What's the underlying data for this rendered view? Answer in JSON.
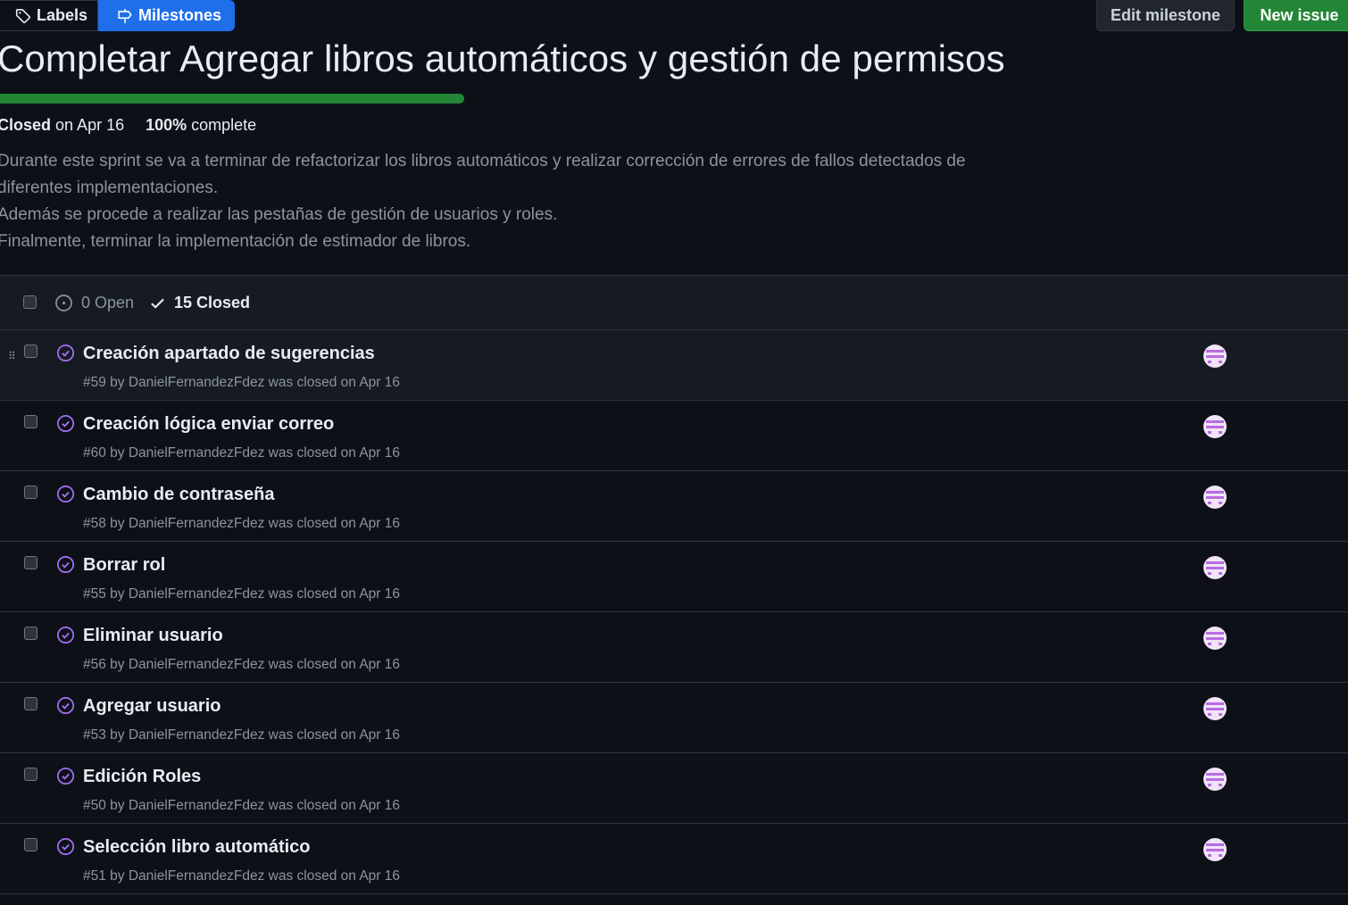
{
  "nav": {
    "labels_label": "Labels",
    "milestones_label": "Milestones",
    "edit_milestone_label": "Edit milestone",
    "new_issue_label": "New issue"
  },
  "milestone": {
    "title": "Completar Agregar libros automáticos y gestión de permisos",
    "progress_fraction": 1.0,
    "status": "Closed",
    "status_date": "on Apr 16",
    "percent": "100%",
    "percent_suffix": "complete",
    "description": [
      "Durante este sprint se va a terminar de refactorizar los libros automáticos y realizar corrección de errores de fallos detectados de",
      "diferentes implementaciones.",
      "Además se procede a realizar las pestañas de gestión de usuarios y roles.",
      "Finalmente, terminar la implementación de estimador de libros."
    ]
  },
  "list": {
    "open_count": "0 Open",
    "closed_count": "15 Closed",
    "issues": [
      {
        "title": "Creación apartado de sugerencias",
        "subtitle": "#59 by DanielFernandezFdez was closed on Apr 16"
      },
      {
        "title": "Creación lógica enviar correo",
        "subtitle": "#60 by DanielFernandezFdez was closed on Apr 16"
      },
      {
        "title": "Cambio de contraseña",
        "subtitle": "#58 by DanielFernandezFdez was closed on Apr 16"
      },
      {
        "title": "Borrar rol",
        "subtitle": "#55 by DanielFernandezFdez was closed on Apr 16"
      },
      {
        "title": "Eliminar usuario",
        "subtitle": "#56 by DanielFernandezFdez was closed on Apr 16"
      },
      {
        "title": "Agregar usuario",
        "subtitle": "#53 by DanielFernandezFdez was closed on Apr 16"
      },
      {
        "title": "Edición Roles",
        "subtitle": "#50 by DanielFernandezFdez was closed on Apr 16"
      },
      {
        "title": "Selección libro automático",
        "subtitle": "#51 by DanielFernandezFdez was closed on Apr 16"
      }
    ]
  },
  "colors": {
    "background": "#0d1117",
    "accent_blue": "#1f6feb",
    "success_green": "#238636",
    "closed_purple": "#a371f7",
    "muted_text": "#8b949e"
  },
  "icons": {
    "labels": "tag-icon",
    "milestones": "milestone-icon",
    "open_state": "issue-opened-icon",
    "closed_state": "check-icon",
    "issue_closed": "issue-closed-icon",
    "drag": "drag-handle-icon"
  }
}
